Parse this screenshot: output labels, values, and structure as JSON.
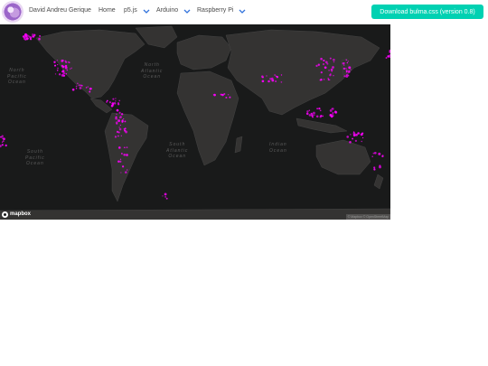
{
  "navbar": {
    "brand_name": "David Andreu Gerique",
    "home": "Home",
    "menus": [
      {
        "label": "p5.js"
      },
      {
        "label": "Arduino"
      },
      {
        "label": "Raspberry Pi"
      }
    ],
    "download_button": "Download bulma.css (version 0.8)"
  },
  "map": {
    "oceans": [
      {
        "label": "North\nPacific\nOcean"
      },
      {
        "label": "North\nAtlantic\nOcean"
      },
      {
        "label": "South\nPacific\nOcean"
      },
      {
        "label": "South\nAtlantic\nOcean"
      },
      {
        "label": "Indian\nOcean"
      }
    ],
    "logo_text": "mapbox",
    "attribution": "© Mapbox © OpenStreetMap",
    "colors": {
      "water": "#191a1a",
      "land": "#343332",
      "border": "#4a4a4a",
      "marker": "#ff00ff"
    }
  },
  "colors": {
    "accent": "#00d1b2",
    "chevron": "#3273dc"
  }
}
